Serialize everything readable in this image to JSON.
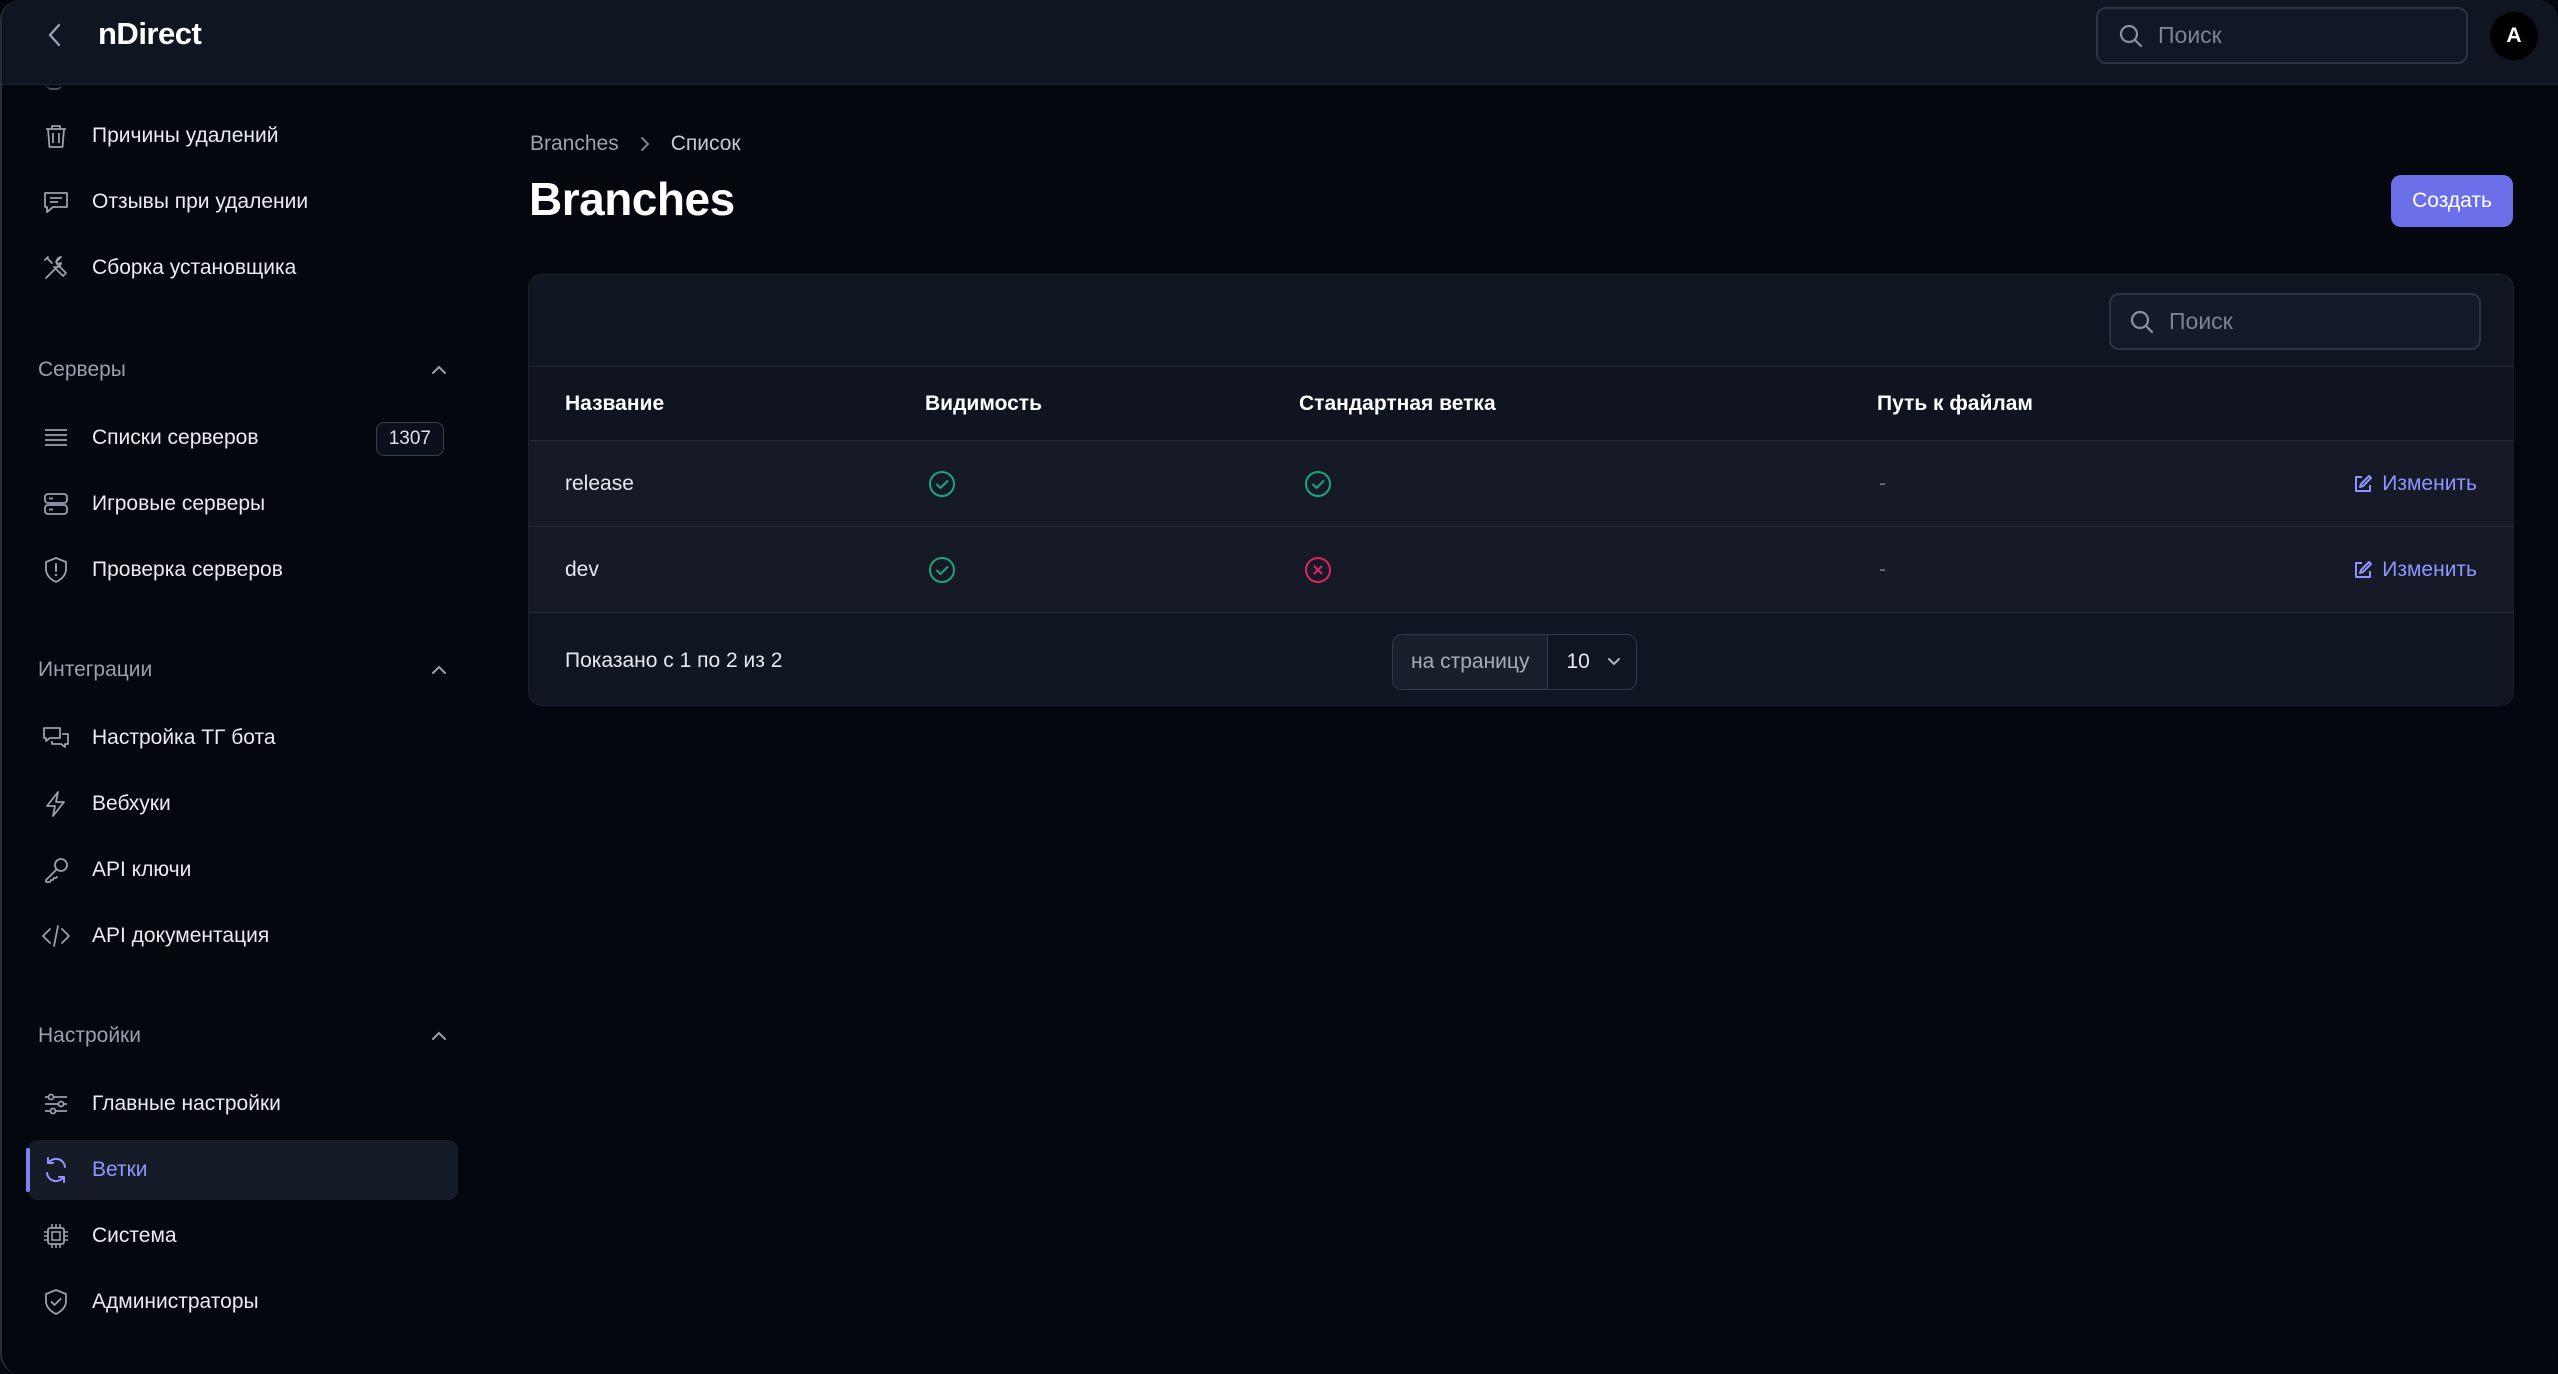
{
  "app": {
    "brand": "nDirect",
    "avatar_initial": "A"
  },
  "topbar": {
    "search_placeholder": "Поиск"
  },
  "sidebar": {
    "items_top": [
      {
        "label": "Причины удалений",
        "icon": "trash-icon"
      },
      {
        "label": "Отзывы при удалении",
        "icon": "message-icon"
      },
      {
        "label": "Сборка установщика",
        "icon": "tools-icon"
      }
    ],
    "groups": [
      {
        "label": "Серверы",
        "items": [
          {
            "label": "Списки серверов",
            "icon": "list-icon",
            "badge": "1307"
          },
          {
            "label": "Игровые серверы",
            "icon": "server-icon"
          },
          {
            "label": "Проверка серверов",
            "icon": "shield-alert-icon"
          }
        ]
      },
      {
        "label": "Интеграции",
        "items": [
          {
            "label": "Настройка ТГ бота",
            "icon": "chat-icon"
          },
          {
            "label": "Вебхуки",
            "icon": "bolt-icon"
          },
          {
            "label": "API ключи",
            "icon": "key-icon"
          },
          {
            "label": "API документация",
            "icon": "code-icon"
          }
        ]
      },
      {
        "label": "Настройки",
        "items": [
          {
            "label": "Главные настройки",
            "icon": "sliders-icon"
          },
          {
            "label": "Ветки",
            "icon": "refresh-icon",
            "active": true
          },
          {
            "label": "Система",
            "icon": "chip-icon"
          },
          {
            "label": "Администраторы",
            "icon": "shield-check-icon"
          }
        ]
      }
    ]
  },
  "breadcrumbs": [
    "Branches",
    "Список"
  ],
  "page": {
    "title": "Branches",
    "create_label": "Создать"
  },
  "table": {
    "search_placeholder": "Поиск",
    "columns": [
      "Название",
      "Видимость",
      "Стандартная ветка",
      "Путь к файлам"
    ],
    "rows": [
      {
        "name": "release",
        "visible": true,
        "default": true,
        "path": "-",
        "action": "Изменить"
      },
      {
        "name": "dev",
        "visible": true,
        "default": false,
        "path": "-",
        "action": "Изменить"
      }
    ],
    "footer": {
      "shown": "Показано с 1 по 2 из 2",
      "per_page_label": "на страницу",
      "per_page_value": "10"
    }
  },
  "colors": {
    "accent": "#6b70e8",
    "link": "#8e95ff",
    "success": "#1fa37a",
    "danger": "#e0245e"
  }
}
